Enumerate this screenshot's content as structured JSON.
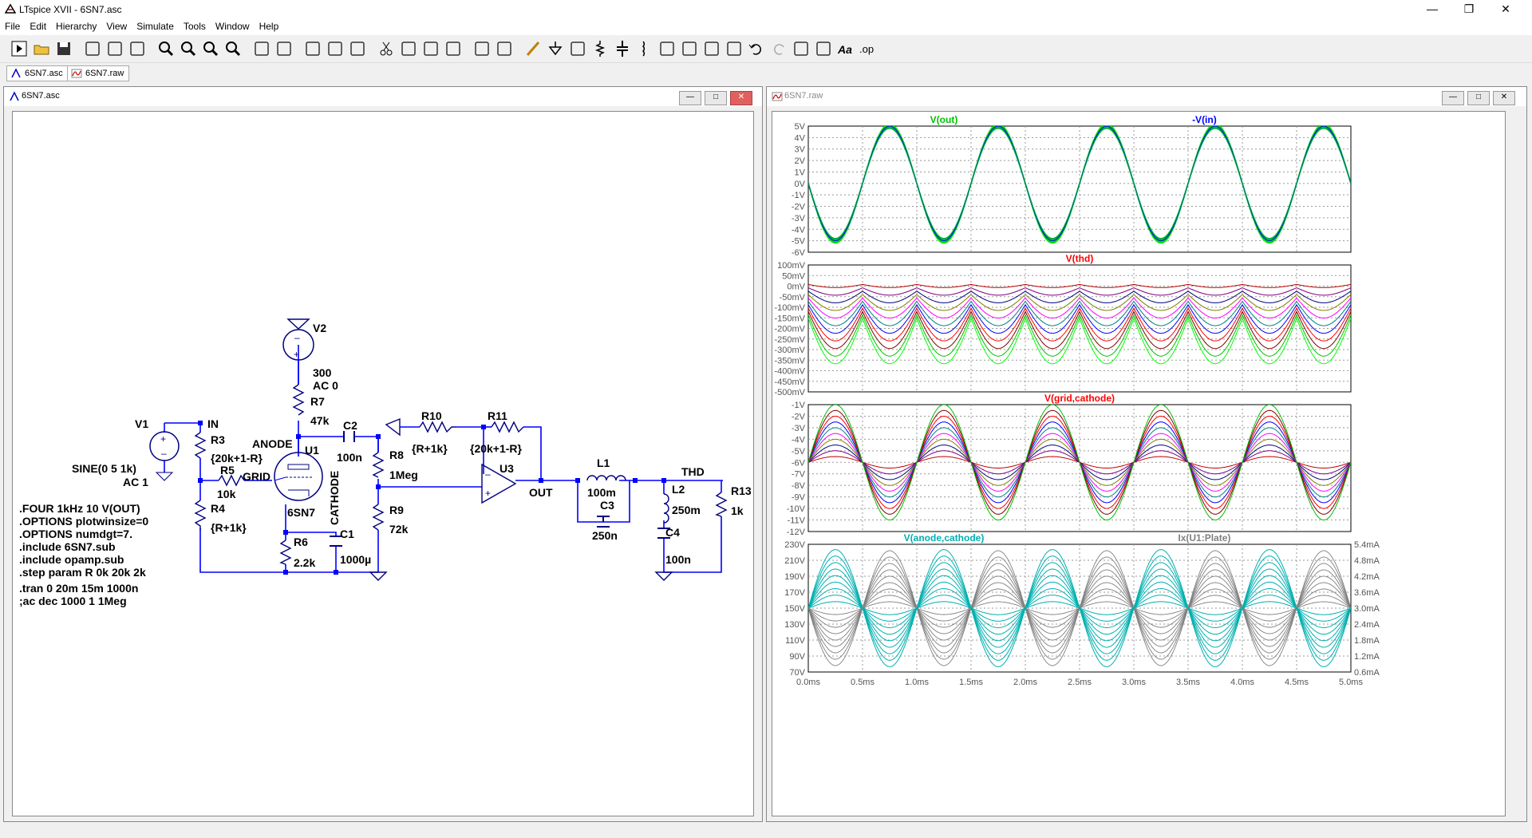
{
  "app": {
    "title": "LTspice XVII - 6SN7.asc"
  },
  "window_controls": {
    "minimize": "—",
    "maximize": "❐",
    "close": "✕"
  },
  "menu": [
    "File",
    "Edit",
    "Hierarchy",
    "View",
    "Simulate",
    "Tools",
    "Window",
    "Help"
  ],
  "toolbar": {
    "icons": [
      "run-icon",
      "open-icon",
      "save-icon",
      "control-panel-icon",
      "halt-icon",
      "pan-icon",
      "zoom-in-icon",
      "zoom-area-icon",
      "zoom-out-icon",
      "zoom-cancel-icon",
      "autorange-icon",
      "plot-settings-icon",
      "tile-horizontal-icon",
      "cascade-icon",
      "tile-vertical-icon",
      "cut-icon",
      "copy-icon",
      "paste-icon",
      "find-icon",
      "print-icon",
      "print-preview-icon",
      "draw-wire-icon",
      "ground-icon",
      "label-net-icon",
      "resistor-icon",
      "capacitor-icon",
      "inductor-icon",
      "diode-icon",
      "component-icon",
      "move-icon",
      "drag-icon",
      "undo-icon",
      "redo-icon",
      "rotate-icon",
      "mirror-icon",
      "text-icon",
      "spice-directive-icon"
    ],
    "text_label": "Aa",
    "directive_label": ".op"
  },
  "tabs": [
    {
      "label": "6SN7.asc"
    },
    {
      "label": "6SN7.raw"
    }
  ],
  "schematic_window": {
    "title": "6SN7.asc"
  },
  "waveform_window": {
    "title": "6SN7.raw"
  },
  "mdi_buttons": {
    "min": "—",
    "max": "□",
    "close": "✕"
  },
  "schematic": {
    "labels": {
      "v2": "V2",
      "v2_val1": "300",
      "v2_val2": "AC 0",
      "r7": "R7",
      "r7_val": "47k",
      "anode": "ANODE",
      "u1": "U1",
      "c2": "C2",
      "c2_val": "100n",
      "r8": "R8",
      "r8_val": "1Meg",
      "r10": "R10",
      "r10_val": "{R+1k}",
      "r11": "R11",
      "r11_val": "{20k+1-R}",
      "u3": "U3",
      "out": "OUT",
      "v1": "V1",
      "v1_val1": "SINE(0 5 1k)",
      "v1_val2": "AC 1",
      "in": "IN",
      "r3": "R3",
      "r3_val": "{20k+1-R}",
      "r5": "R5",
      "r5_val": "10k",
      "grid": "GRID",
      "r4": "R4",
      "r4_val": "{R+1k}",
      "tube": "6SN7",
      "cathode": "CATHODE",
      "r9": "R9",
      "r9_val": "72k",
      "r6": "R6",
      "r6_val": "2.2k",
      "c1": "C1",
      "c1_val": "1000µ",
      "l1": "L1",
      "l1_val": "100m",
      "c3": "C3",
      "c3_val": "250n",
      "thd": "THD",
      "l2": "L2",
      "l2_val": "250m",
      "c4": "C4",
      "c4_val": "100n",
      "r13": "R13",
      "r13_val": "1k"
    },
    "directives": [
      ".FOUR 1kHz 10 V(OUT)",
      ".OPTIONS plotwinsize=0",
      ".OPTIONS numdgt=7.",
      ".include 6SN7.sub",
      ".include opamp.sub",
      ".step param R 0k 20k 2k",
      ".tran 0 20m 15m 1000n",
      ";ac dec 1000 1 1Meg"
    ]
  },
  "chart_data": [
    {
      "type": "line",
      "title": "",
      "traces": [
        {
          "name": "V(out)",
          "color": "#00c000"
        },
        {
          "name": "-V(in)",
          "color": "#0000ff"
        }
      ],
      "ylim": [
        -6,
        5
      ],
      "yticks": [
        "5V",
        "4V",
        "3V",
        "2V",
        "1V",
        "0V",
        "-1V",
        "-2V",
        "-3V",
        "-4V",
        "-5V",
        "-6V"
      ],
      "x": [
        0,
        0.25,
        0.5,
        0.75,
        1.0
      ],
      "series": [
        {
          "name": "V(out)",
          "values": [
            0,
            -5.0,
            0,
            5.0,
            0
          ],
          "period_ms": 1.0
        }
      ],
      "xlim_ms": [
        0,
        5
      ]
    },
    {
      "type": "line",
      "traces": [
        {
          "name": "V(thd)",
          "color": "#ff0000"
        }
      ],
      "ylim": [
        -500,
        100
      ],
      "yticks": [
        "100mV",
        "50mV",
        "0mV",
        "-50mV",
        "-100mV",
        "-150mV",
        "-200mV",
        "-250mV",
        "-300mV",
        "-350mV",
        "-400mV",
        "-450mV",
        "-500mV"
      ],
      "step_amplitudes_mV": [
        30,
        70,
        110,
        150,
        190,
        230,
        270,
        310,
        350,
        390,
        430
      ],
      "xlim_ms": [
        0,
        5
      ]
    },
    {
      "type": "line",
      "traces": [
        {
          "name": "V(grid,cathode)",
          "color": "#ff0000"
        }
      ],
      "ylim": [
        -12,
        -1
      ],
      "yticks": [
        "-1V",
        "-2V",
        "-3V",
        "-4V",
        "-5V",
        "-6V",
        "-7V",
        "-8V",
        "-9V",
        "-10V",
        "-11V",
        "-12V"
      ],
      "center_V": -6,
      "step_amplitudes_V": [
        0.5,
        1.0,
        1.5,
        2.0,
        2.5,
        3.0,
        3.5,
        4.0,
        4.5,
        5.0
      ],
      "xlim_ms": [
        0,
        5
      ]
    },
    {
      "type": "line",
      "traces": [
        {
          "name": "V(anode,cathode)",
          "color": "#00b0b0"
        },
        {
          "name": "Ix(U1:Plate)",
          "color": "#808080"
        }
      ],
      "ylim": [
        70,
        230
      ],
      "yticks": [
        "230V",
        "210V",
        "190V",
        "170V",
        "150V",
        "130V",
        "110V",
        "90V",
        "70V"
      ],
      "yticks_right": [
        "5.4mA",
        "4.8mA",
        "4.2mA",
        "3.6mA",
        "3.0mA",
        "2.4mA",
        "1.8mA",
        "1.2mA",
        "0.6mA"
      ],
      "center_V": 150,
      "step_amplitudes_V": [
        8,
        16,
        24,
        32,
        40,
        48,
        56,
        64,
        72
      ],
      "xticks": [
        "0.0ms",
        "0.5ms",
        "1.0ms",
        "1.5ms",
        "2.0ms",
        "2.5ms",
        "3.0ms",
        "3.5ms",
        "4.0ms",
        "4.5ms",
        "5.0ms"
      ],
      "xlim_ms": [
        0,
        5
      ]
    }
  ],
  "colors": {
    "wire": "#0000ff",
    "component": "#000080",
    "step_palette": [
      "#00ff00",
      "#00c000",
      "#800000",
      "#ff0000",
      "#0000ff",
      "#008080",
      "#ff00ff",
      "#808000",
      "#000080",
      "#800080",
      "#c00000"
    ]
  }
}
